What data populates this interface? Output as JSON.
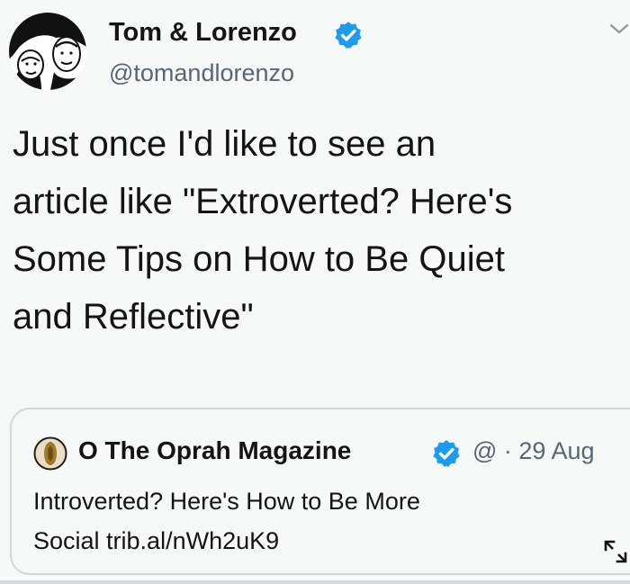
{
  "tweet": {
    "display_name": "Tom & Lorenzo",
    "handle": "@tomandlorenzo",
    "text_lines": [
      "Just once I'd like to see an",
      "article like \"Extroverted? Here's",
      "Some Tips on How to Be Quiet",
      "and Reflective\""
    ],
    "verified": true
  },
  "quote": {
    "author_name": "O The Oprah Magazine",
    "meta": "@ · 29 Aug",
    "text_lines": [
      "Introverted? Here's How to Be More",
      "Social trib.al/nWh2uK9"
    ],
    "verified": true
  },
  "colors": {
    "verified_blue": "#1d9bf0",
    "secondary_text": "#5b6670",
    "border": "#cfd9de",
    "background": "#f7f8f8"
  },
  "icons": {
    "avatar": "caricature-avatar",
    "verified": "verified-badge-icon",
    "more": "chevron-down-icon",
    "quote_avatar": "oprah-logo-icon",
    "expand": "expand-icon"
  }
}
